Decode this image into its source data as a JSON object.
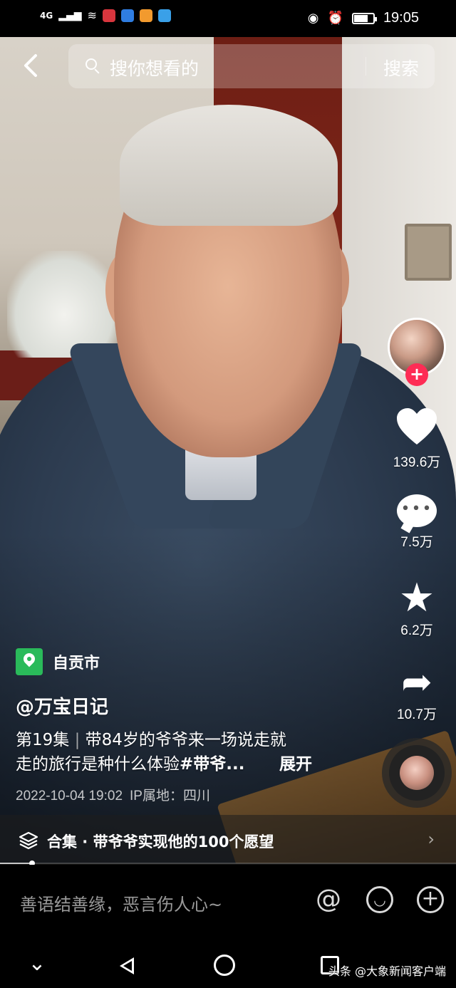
{
  "status_bar": {
    "signal": "4G",
    "time": "19:05",
    "battery_level": 0.75
  },
  "search": {
    "placeholder": "搜你想看的",
    "button": "搜索"
  },
  "right_rail": {
    "likes": "139.6万",
    "comments": "7.5万",
    "favorites": "6.2万",
    "shares": "10.7万"
  },
  "video_info": {
    "location": "自贡市",
    "author": "@万宝日记",
    "episode": "第19集",
    "desc_line1_rest": "带84岁的爷爷来一场说走就",
    "desc_line2": "走的旅行是种什么体验",
    "hashtag": "#带爷...",
    "expand": "展开",
    "date": "2022-10-04 19:02",
    "ip": "IP属地：四川"
  },
  "collection": {
    "label": "合集 · 带爷爷实现他的100个愿望"
  },
  "progress": 0.07,
  "comment_input": {
    "placeholder": "善语结善缘，恶言伤人心~"
  },
  "watermark": "头条 @大象新闻客户端",
  "colors": {
    "accent_red": "#fe2c55",
    "location_green": "#2aba5a"
  }
}
